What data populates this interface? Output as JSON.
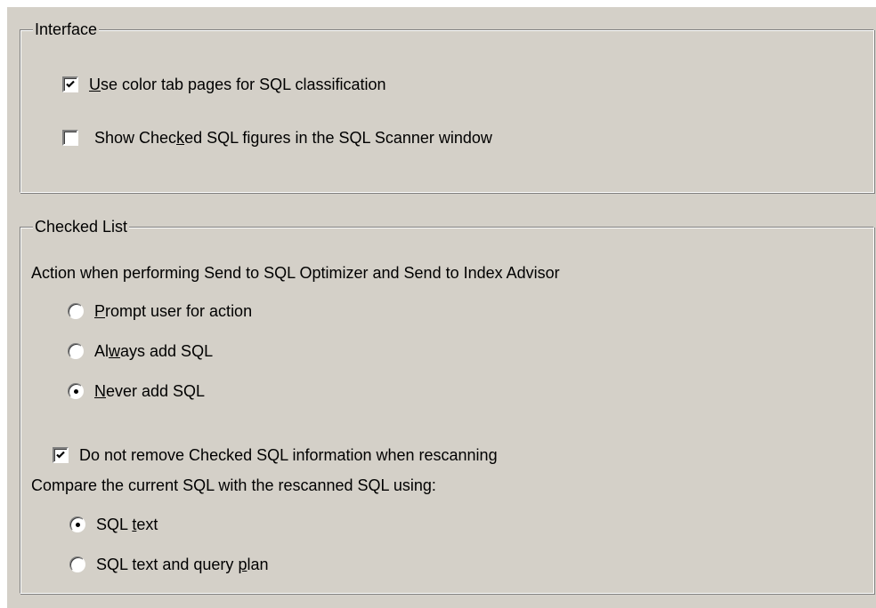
{
  "interface": {
    "title": "Interface",
    "use_color_tabs": {
      "label_pre": "",
      "label_mnemonic": "U",
      "label_post": "se color tab pages for SQL classification",
      "checked": true
    },
    "show_checked_sql": {
      "label_pre": "Show Chec",
      "label_mnemonic": "k",
      "label_post": "ed SQL figures in the SQL Scanner window",
      "checked": false
    }
  },
  "checked_list": {
    "title": "Checked List",
    "action_caption": "Action when performing Send to SQL Optimizer and Send to Index Advisor",
    "action_options": [
      {
        "pre": "",
        "mnemonic": "P",
        "post": "rompt user for action",
        "selected": false
      },
      {
        "pre": "Al",
        "mnemonic": "w",
        "post": "ays add SQL",
        "selected": false
      },
      {
        "pre": "",
        "mnemonic": "N",
        "post": "ever add SQL",
        "selected": true
      }
    ],
    "do_not_remove": {
      "label": "Do not remove Checked SQL information when rescanning",
      "checked": true
    },
    "compare_caption": "Compare the current SQL with the rescanned SQL using:",
    "compare_options": [
      {
        "pre": "SQL ",
        "mnemonic": "t",
        "post": "ext",
        "selected": true
      },
      {
        "pre": "SQL text and query ",
        "mnemonic": "p",
        "post": "lan",
        "selected": false
      }
    ]
  }
}
